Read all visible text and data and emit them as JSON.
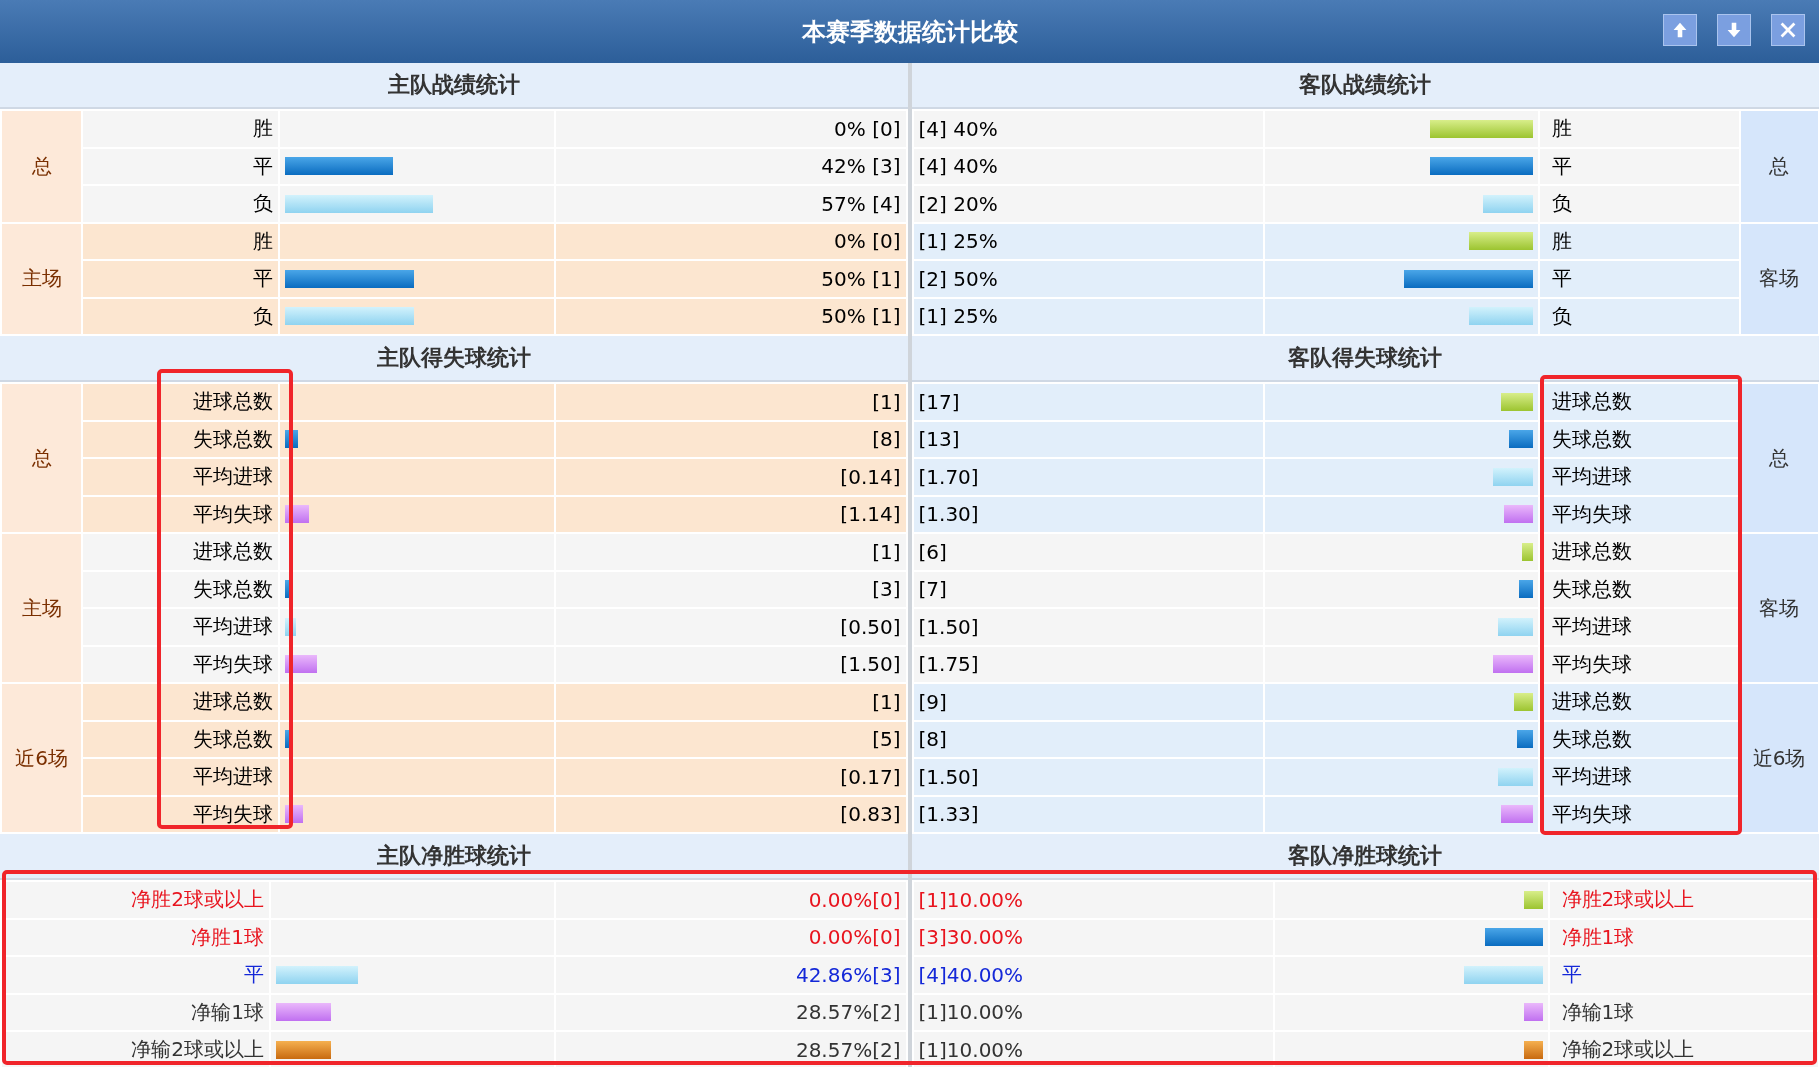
{
  "window": {
    "title": "本赛季数据统计比较"
  },
  "sections": [
    {
      "kind": "grouped",
      "home": {
        "title": "主队战绩统计",
        "groups": [
          {
            "label": "总",
            "shaded": false,
            "rows": [
              {
                "label": "胜",
                "kind": "win",
                "level": 0,
                "value": "0% [0]"
              },
              {
                "label": "平",
                "kind": "draw",
                "level": 0.41,
                "value": "42% [3]"
              },
              {
                "label": "负",
                "kind": "loss",
                "level": 0.56,
                "value": "57% [4]"
              }
            ]
          },
          {
            "label": "主场",
            "shaded": true,
            "rows": [
              {
                "label": "胜",
                "kind": "win",
                "level": 0,
                "value": "0% [0]"
              },
              {
                "label": "平",
                "kind": "draw",
                "level": 0.49,
                "value": "50% [1]"
              },
              {
                "label": "负",
                "kind": "loss",
                "level": 0.49,
                "value": "50% [1]"
              }
            ]
          }
        ]
      },
      "away": {
        "title": "客队战绩统计",
        "groups": [
          {
            "label": "总",
            "shaded": false,
            "rows": [
              {
                "label": "胜",
                "kind": "win",
                "level": 0.39,
                "value": "[4] 40%"
              },
              {
                "label": "平",
                "kind": "draw",
                "level": 0.39,
                "value": "[4] 40%"
              },
              {
                "label": "负",
                "kind": "loss",
                "level": 0.19,
                "value": "[2] 20%"
              }
            ]
          },
          {
            "label": "客场",
            "shaded": true,
            "rows": [
              {
                "label": "胜",
                "kind": "win",
                "level": 0.24,
                "value": "[1] 25%"
              },
              {
                "label": "平",
                "kind": "draw",
                "level": 0.49,
                "value": "[2] 50%"
              },
              {
                "label": "负",
                "kind": "loss",
                "level": 0.24,
                "value": "[1] 25%"
              }
            ]
          }
        ]
      }
    },
    {
      "kind": "grouped",
      "home": {
        "title": "主队得失球统计",
        "groups": [
          {
            "label": "总",
            "shaded": true,
            "rows": [
              {
                "label": "进球总数",
                "kind": "scored",
                "level": 0,
                "value": "[1]"
              },
              {
                "label": "失球总数",
                "kind": "conceded",
                "level": 0.05,
                "value": "[8]"
              },
              {
                "label": "平均进球",
                "kind": "avg-scored",
                "level": 0,
                "value": "[0.14]"
              },
              {
                "label": "平均失球",
                "kind": "avg-conceded",
                "level": 0.09,
                "value": "[1.14]"
              }
            ]
          },
          {
            "label": "主场",
            "shaded": false,
            "rows": [
              {
                "label": "进球总数",
                "kind": "scored",
                "level": 0,
                "value": "[1]"
              },
              {
                "label": "失球总数",
                "kind": "conceded",
                "level": 0.015,
                "value": "[3]"
              },
              {
                "label": "平均进球",
                "kind": "avg-scored",
                "level": 0.04,
                "value": "[0.50]"
              },
              {
                "label": "平均失球",
                "kind": "avg-conceded",
                "level": 0.12,
                "value": "[1.50]"
              }
            ]
          },
          {
            "label": "近6场",
            "shaded": true,
            "rows": [
              {
                "label": "进球总数",
                "kind": "scored",
                "level": 0,
                "value": "[1]"
              },
              {
                "label": "失球总数",
                "kind": "conceded",
                "level": 0.03,
                "value": "[5]"
              },
              {
                "label": "平均进球",
                "kind": "avg-scored",
                "level": 0,
                "value": "[0.17]"
              },
              {
                "label": "平均失球",
                "kind": "avg-conceded",
                "level": 0.07,
                "value": "[0.83]"
              }
            ]
          }
        ]
      },
      "away": {
        "title": "客队得失球统计",
        "groups": [
          {
            "label": "总",
            "shaded": true,
            "rows": [
              {
                "label": "进球总数",
                "kind": "scored",
                "level": 0.12,
                "value": "[17]"
              },
              {
                "label": "失球总数",
                "kind": "conceded",
                "level": 0.09,
                "value": "[13]"
              },
              {
                "label": "平均进球",
                "kind": "avg-scored",
                "level": 0.15,
                "value": "[1.70]"
              },
              {
                "label": "平均失球",
                "kind": "avg-conceded",
                "level": 0.11,
                "value": "[1.30]"
              }
            ]
          },
          {
            "label": "客场",
            "shaded": false,
            "rows": [
              {
                "label": "进球总数",
                "kind": "scored",
                "level": 0.04,
                "value": "[6]"
              },
              {
                "label": "失球总数",
                "kind": "conceded",
                "level": 0.05,
                "value": "[7]"
              },
              {
                "label": "平均进球",
                "kind": "avg-scored",
                "level": 0.13,
                "value": "[1.50]"
              },
              {
                "label": "平均失球",
                "kind": "avg-conceded",
                "level": 0.15,
                "value": "[1.75]"
              }
            ]
          },
          {
            "label": "近6场",
            "shaded": true,
            "rows": [
              {
                "label": "进球总数",
                "kind": "scored",
                "level": 0.07,
                "value": "[9]"
              },
              {
                "label": "失球总数",
                "kind": "conceded",
                "level": 0.06,
                "value": "[8]"
              },
              {
                "label": "平均进球",
                "kind": "avg-scored",
                "level": 0.13,
                "value": "[1.50]"
              },
              {
                "label": "平均失球",
                "kind": "avg-conceded",
                "level": 0.12,
                "value": "[1.33]"
              }
            ]
          }
        ]
      }
    },
    {
      "kind": "flat",
      "home": {
        "title": "主队净胜球统计",
        "rows": [
          {
            "label": "净胜2球或以上",
            "kind": "net-win2",
            "level": 0,
            "value": "0.00%[0]"
          },
          {
            "label": "净胜1球",
            "kind": "net-win1",
            "level": 0,
            "value": "0.00%[0]"
          },
          {
            "label": "平",
            "kind": "net-draw",
            "level": 0.3,
            "value": "42.86%[3]"
          },
          {
            "label": "净输1球",
            "kind": "net-lose1",
            "level": 0.2,
            "value": "28.57%[2]"
          },
          {
            "label": "净输2球或以上",
            "kind": "net-lose2",
            "level": 0.2,
            "value": "28.57%[2]"
          }
        ]
      },
      "away": {
        "title": "客队净胜球统计",
        "rows": [
          {
            "label": "净胜2球或以上",
            "kind": "net-win2",
            "level": 0.07,
            "value": "[1]10.00%"
          },
          {
            "label": "净胜1球",
            "kind": "net-win1",
            "level": 0.22,
            "value": "[3]30.00%"
          },
          {
            "label": "平",
            "kind": "net-draw",
            "level": 0.3,
            "value": "[4]40.00%"
          },
          {
            "label": "净输1球",
            "kind": "net-lose1",
            "level": 0.07,
            "value": "[1]10.00%"
          },
          {
            "label": "净输2球或以上",
            "kind": "net-lose2",
            "level": 0.07,
            "value": "[1]10.00%"
          }
        ]
      }
    }
  ],
  "highlight_boxes": [
    {
      "kind": "home-goal-labels"
    },
    {
      "kind": "away-goal-labels"
    },
    {
      "kind": "net-section"
    }
  ]
}
